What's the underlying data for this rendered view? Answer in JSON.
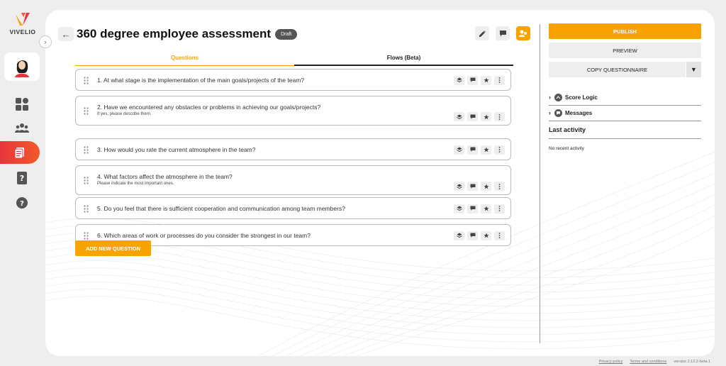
{
  "brand": {
    "name": "VIVELIO",
    "accent": "#f9a300",
    "active_gradient": [
      "#e8353c",
      "#f15a2a"
    ]
  },
  "sidebar": {
    "items": [
      {
        "name": "dashboard",
        "icon": "grid-icon"
      },
      {
        "name": "team",
        "icon": "users-icon"
      },
      {
        "name": "questionnaires",
        "icon": "document-icon",
        "active": true
      },
      {
        "name": "reports",
        "icon": "book-question-icon"
      },
      {
        "name": "help",
        "icon": "help-circle-icon"
      }
    ]
  },
  "header": {
    "title": "360 degree employee assessment",
    "status": "Draft"
  },
  "tabs": [
    {
      "label": "Questions",
      "active": true
    },
    {
      "label": "Flows (Beta)",
      "active": false
    }
  ],
  "questions": [
    {
      "text": "1. At what stage is the implementation of the main goals/projects of the team?",
      "sub": ""
    },
    {
      "text": "2. Have we encountered any obstacles or problems in achieving our goals/projects?",
      "sub": "If yes, please describe them."
    },
    {
      "text": "3. How would you rate the current atmosphere in the team?",
      "sub": ""
    },
    {
      "text": "4. What factors affect the atmosphere in the team?",
      "sub": "Please indicate the most important ones."
    },
    {
      "text": "5. Do you feel that there is sufficient cooperation and communication among team members?",
      "sub": ""
    },
    {
      "text": "6. Which areas of work or processes do you consider the strongest in our team?",
      "sub": ""
    }
  ],
  "add_question_label": "ADD NEW QUESTION",
  "right_panel": {
    "publish": "PUBLISH",
    "preview": "PREVIEW",
    "copy": "COPY QUESTIONNAIRE",
    "score_logic": "Score Logic",
    "messages": "Messages",
    "last_activity": "Last activity",
    "no_recent": "No recent activity"
  },
  "footer": {
    "privacy": "Privacy policy",
    "terms": "Terms and conditions",
    "version": "version 2.12.2-beta.1"
  }
}
